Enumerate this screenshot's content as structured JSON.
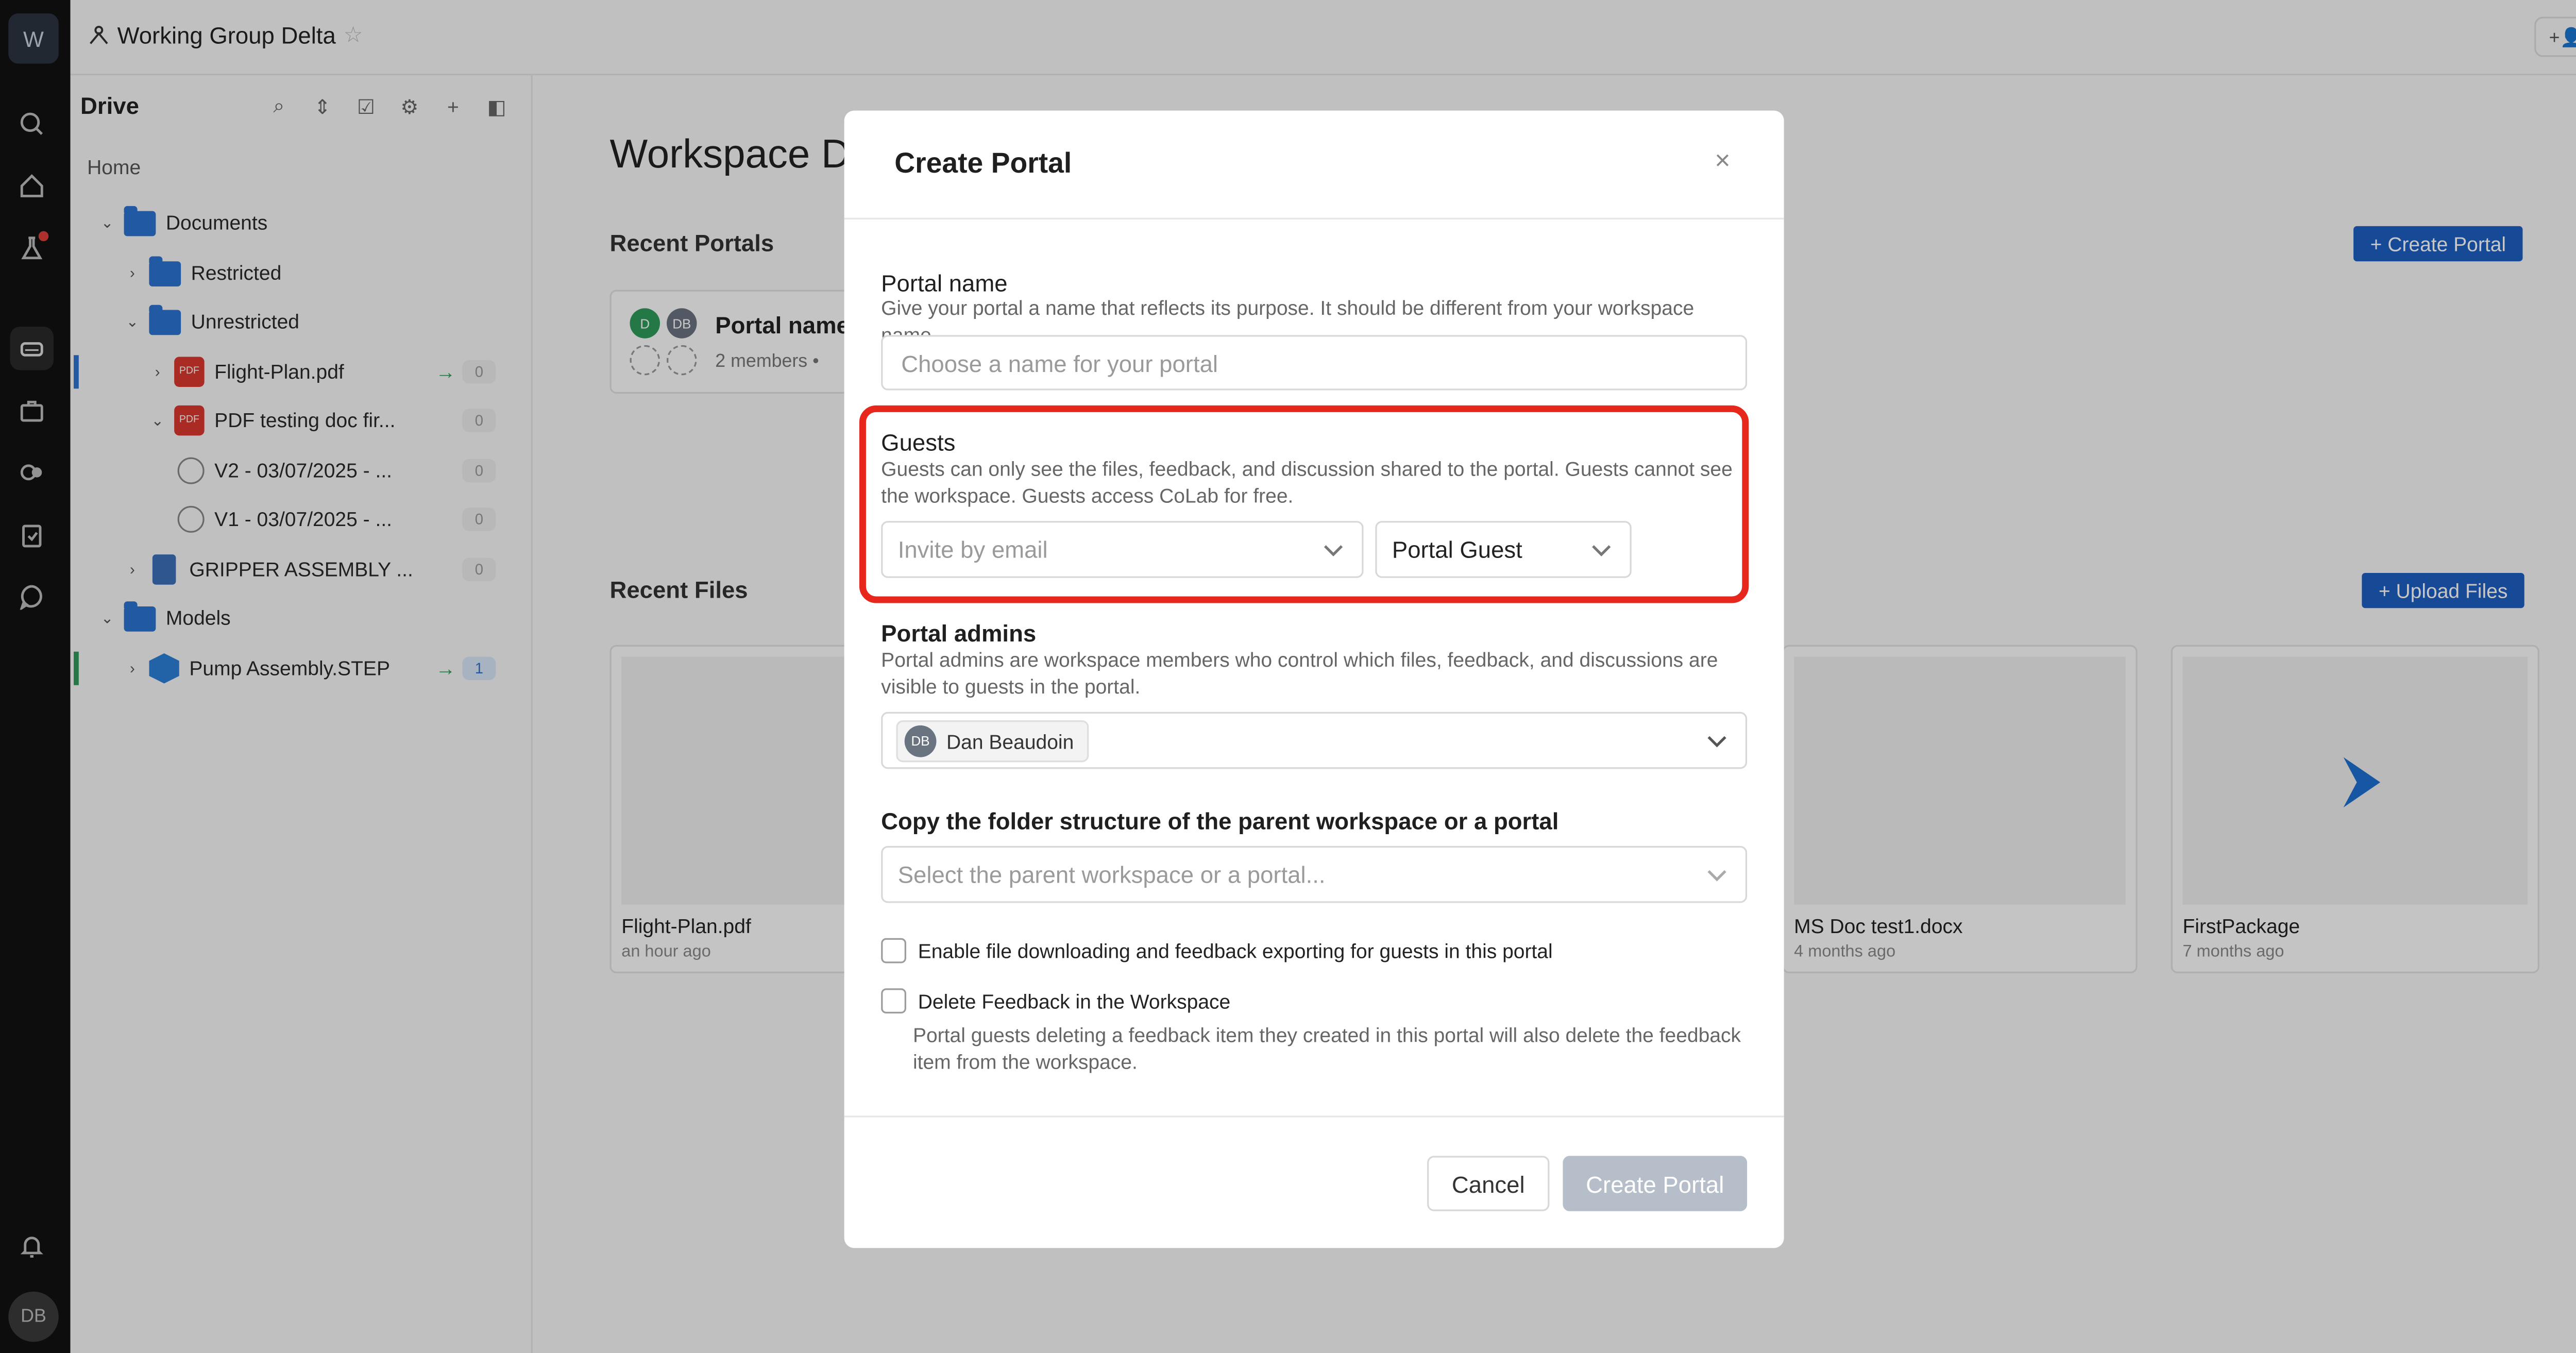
{
  "workspace": {
    "initial": "W",
    "title": "Working Group Delta",
    "member_count": "2"
  },
  "user": {
    "initials": "DB"
  },
  "drive": {
    "title": "Drive",
    "home_label": "Home",
    "tree": {
      "documents": "Documents",
      "restricted": "Restricted",
      "unrestricted": "Unrestricted",
      "flight_plan": "Flight-Plan.pdf",
      "flight_plan_count": "0",
      "pdf_testing": "PDF testing doc fir...",
      "pdf_testing_count": "0",
      "v2": "V2 - 03/07/2025 - ...",
      "v2_count": "0",
      "v1": "V1 - 03/07/2025 - ...",
      "v1_count": "0",
      "gripper": "GRIPPER ASSEMBLY ...",
      "gripper_count": "0",
      "models": "Models",
      "pump": "Pump Assembly.STEP",
      "pump_count": "1",
      "pdf_badge": "PDF"
    }
  },
  "main": {
    "title": "Workspace D",
    "recent_portals": "Recent Portals",
    "create_portal_btn": "+ Create Portal",
    "portal_card": {
      "name": "Portal name",
      "members": "2 members  •",
      "avatar_d": "D",
      "avatar_db": "DB"
    },
    "recent_files": "Recent Files",
    "upload_btn": "+ Upload Files",
    "files": [
      {
        "name": "Flight-Plan.pdf",
        "time": "an hour ago"
      },
      {
        "name": "MS Doc test1.docx",
        "time": "4 months ago"
      },
      {
        "name": "FirstPackage",
        "time": "7 months ago"
      }
    ]
  },
  "modal": {
    "title": "Create Portal",
    "close": "×",
    "portal_name": {
      "label": "Portal name",
      "hint": "Give your portal a name that reflects its purpose. It should be different from your workspace name.",
      "placeholder": "Choose a name for your portal"
    },
    "guests": {
      "label": "Guests",
      "hint": "Guests can only see the files, feedback, and discussion shared to the portal. Guests cannot see the workspace. Guests access CoLab for free.",
      "invite_placeholder": "Invite by email",
      "role": "Portal Guest"
    },
    "admins": {
      "label": "Portal admins",
      "hint": "Portal admins are workspace members who control which files, feedback, and discussions are visible to guests in the portal.",
      "chip_initials": "DB",
      "chip_name": "Dan Beaudoin"
    },
    "copy_structure": {
      "label": "Copy the folder structure of the parent workspace or a portal",
      "placeholder": "Select the parent workspace or a portal..."
    },
    "enable_download": {
      "label": "Enable file downloading and feedback exporting for guests in this portal",
      "checked": false
    },
    "delete_feedback": {
      "label": "Delete Feedback in the Workspace",
      "hint": "Portal guests deleting a feedback item they created in this portal will also delete the feedback item from the workspace.",
      "checked": false
    },
    "cancel": "Cancel",
    "create": "Create Portal"
  },
  "colors": {
    "accent": "#1e5fc0",
    "highlight": "#e8271c",
    "disabled_button": "#b6bfc9"
  }
}
